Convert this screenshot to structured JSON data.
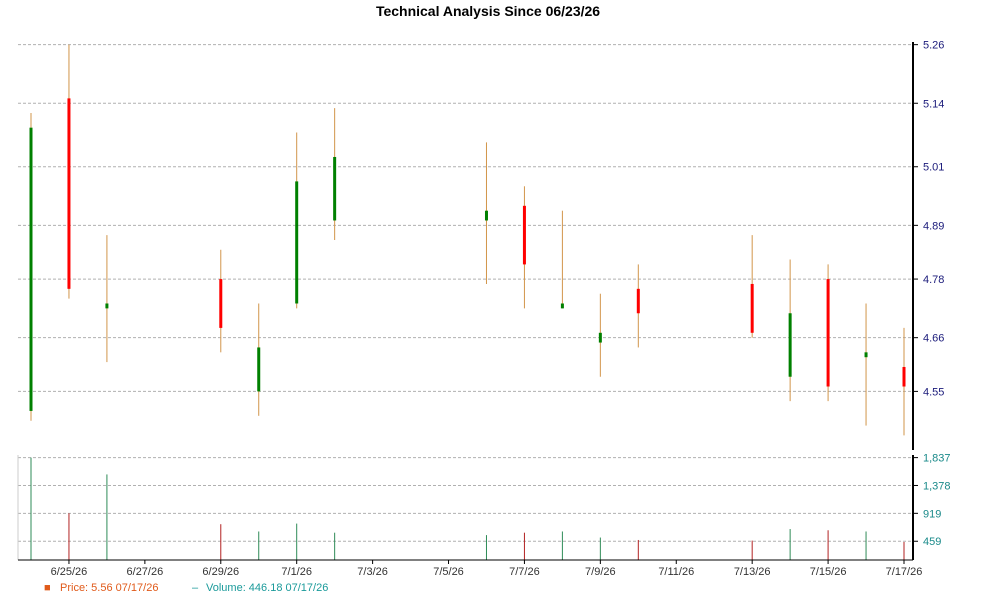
{
  "chart_data": {
    "type": "candlestick",
    "title": "Technical Analysis Since 06/23/26",
    "grid": true,
    "colors": {
      "up": "#008000",
      "down": "#ff0000",
      "wick": "#d2954a",
      "volume_up": "#2e8b57",
      "volume_down": "#b22222",
      "axis": "#000000",
      "grid": "#b0b0b0"
    },
    "price_axis": {
      "range": [
        4.43,
        5.29
      ],
      "ticks": [
        4.55,
        4.66,
        4.78,
        4.89,
        5.01,
        5.14,
        5.26
      ]
    },
    "volume_axis": {
      "range": [
        150,
        1880
      ],
      "ticks": [
        459,
        919,
        1378,
        1837
      ],
      "tick_labels": [
        "459",
        "919",
        "1,378",
        "1,837"
      ]
    },
    "x_axis": {
      "labels": [
        "6/25/26",
        "6/27/26",
        "6/29/26",
        "7/1/26",
        "7/3/26",
        "7/5/26",
        "7/7/26",
        "7/9/26",
        "7/11/26",
        "7/13/26",
        "7/15/26",
        "7/17/26"
      ]
    },
    "candles": [
      {
        "date": "6/24/26",
        "open": 4.51,
        "high": 5.12,
        "low": 4.49,
        "close": 5.09,
        "volume": 1837
      },
      {
        "date": "6/25/26",
        "open": 5.15,
        "high": 5.26,
        "low": 4.74,
        "close": 4.76,
        "volume": 920
      },
      {
        "date": "6/26/26",
        "open": 4.72,
        "high": 4.87,
        "low": 4.61,
        "close": 4.73,
        "volume": 1560
      },
      {
        "date": "6/29/26",
        "open": 4.78,
        "high": 4.84,
        "low": 4.63,
        "close": 4.68,
        "volume": 740
      },
      {
        "date": "6/30/26",
        "open": 4.55,
        "high": 4.73,
        "low": 4.5,
        "close": 4.64,
        "volume": 620
      },
      {
        "date": "7/1/26",
        "open": 4.73,
        "high": 5.08,
        "low": 4.72,
        "close": 4.98,
        "volume": 750
      },
      {
        "date": "7/2/26",
        "open": 4.9,
        "high": 5.13,
        "low": 4.86,
        "close": 5.03,
        "volume": 600
      },
      {
        "date": "7/6/26",
        "open": 4.9,
        "high": 5.06,
        "low": 4.77,
        "close": 4.92,
        "volume": 560
      },
      {
        "date": "7/7/26",
        "open": 4.93,
        "high": 4.97,
        "low": 4.72,
        "close": 4.81,
        "volume": 600
      },
      {
        "date": "7/8/26",
        "open": 4.72,
        "high": 4.92,
        "low": 4.72,
        "close": 4.73,
        "volume": 620
      },
      {
        "date": "7/9/26",
        "open": 4.65,
        "high": 4.75,
        "low": 4.58,
        "close": 4.67,
        "volume": 520
      },
      {
        "date": "7/10/26",
        "open": 4.76,
        "high": 4.81,
        "low": 4.64,
        "close": 4.71,
        "volume": 480
      },
      {
        "date": "7/13/26",
        "open": 4.77,
        "high": 4.87,
        "low": 4.66,
        "close": 4.67,
        "volume": 470
      },
      {
        "date": "7/14/26",
        "open": 4.58,
        "high": 4.82,
        "low": 4.53,
        "close": 4.71,
        "volume": 660
      },
      {
        "date": "7/15/26",
        "open": 4.78,
        "high": 4.81,
        "low": 4.53,
        "close": 4.56,
        "volume": 640
      },
      {
        "date": "7/16/26",
        "open": 4.62,
        "high": 4.73,
        "low": 4.48,
        "close": 4.63,
        "volume": 620
      },
      {
        "date": "7/17/26",
        "open": 4.6,
        "high": 4.68,
        "low": 4.46,
        "close": 4.56,
        "volume": 446
      }
    ],
    "legend": [
      {
        "marker": "■",
        "text": "Price: 5.56  07/17/26",
        "color": "#e05a1a"
      },
      {
        "marker": "–",
        "text": "Volume: 446.18  07/17/26",
        "color": "#1a9a9a"
      }
    ]
  }
}
